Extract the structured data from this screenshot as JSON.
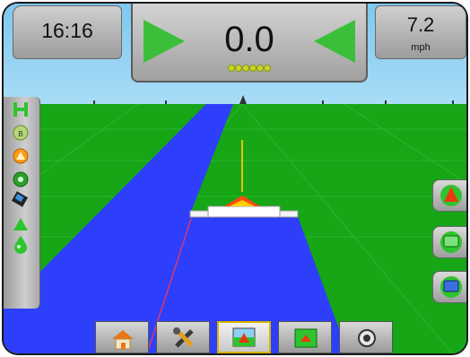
{
  "status": {
    "time": "16:16",
    "cross_track_value": "0.0",
    "speed_value": "7.2",
    "speed_unit": "mph"
  },
  "left_toolbar": {
    "icons": [
      "steering-icon",
      "boom-sections-icon",
      "warning-icon",
      "satellite-icon",
      "implement-icon",
      "gps-arrow-icon",
      "droplet-icon"
    ]
  },
  "right_toolbar": {
    "buttons": [
      "north-arrow-button",
      "view-mode-button",
      "map-view-button"
    ]
  },
  "bottom_tabs": [
    {
      "name": "tab-home",
      "icon": "home-icon"
    },
    {
      "name": "tab-tools",
      "icon": "tools-icon"
    },
    {
      "name": "tab-vehicle-view",
      "icon": "vehicle-view-icon",
      "active": true
    },
    {
      "name": "tab-map-view",
      "icon": "map-view-icon"
    },
    {
      "name": "tab-camera",
      "icon": "camera-icon"
    }
  ],
  "colors": {
    "field": "#16a616",
    "coverage": "#2d3ffb",
    "lightbar_green": "#3bbf3b",
    "active_tab_border": "#d7b400"
  }
}
